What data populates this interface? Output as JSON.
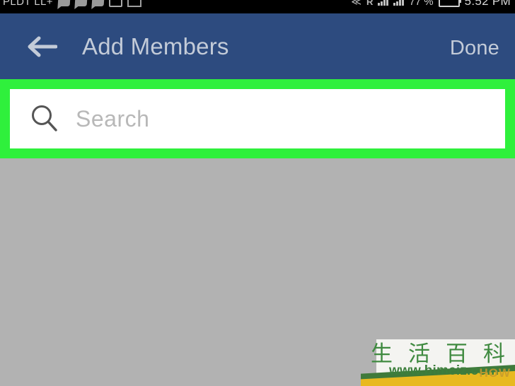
{
  "status_bar": {
    "carrier": "PLDT LL+",
    "time": "5:52 PM",
    "battery_percent": "77 %",
    "left_icons": [
      "chat-icon",
      "chat-icon",
      "chat-icon",
      "image-icon",
      "tray-icon"
    ],
    "right_icons": [
      "mute-icon",
      "roaming-icon",
      "signal-bars-icon",
      "signal-bars-icon",
      "battery-icon"
    ],
    "mute_glyph": "≪",
    "roaming_glyph": "R"
  },
  "app_bar": {
    "back_label": "back",
    "title": "Add Members",
    "done_label": "Done",
    "background_color": "#2d4b7f",
    "text_color": "#c3cbd8"
  },
  "search": {
    "placeholder": "Search",
    "value": "",
    "icon": "search-icon",
    "highlight_color": "#2ff03c",
    "field_background": "#ffffff"
  },
  "list": {
    "background_color": "#b2b2b2",
    "items": []
  },
  "watermark": {
    "cjk_chars": [
      "生",
      "活",
      "百",
      "科"
    ],
    "url": "www.bimeiz.com",
    "how_label": "HOW",
    "green": "#3f7a3b",
    "yellow": "#e8b920"
  }
}
